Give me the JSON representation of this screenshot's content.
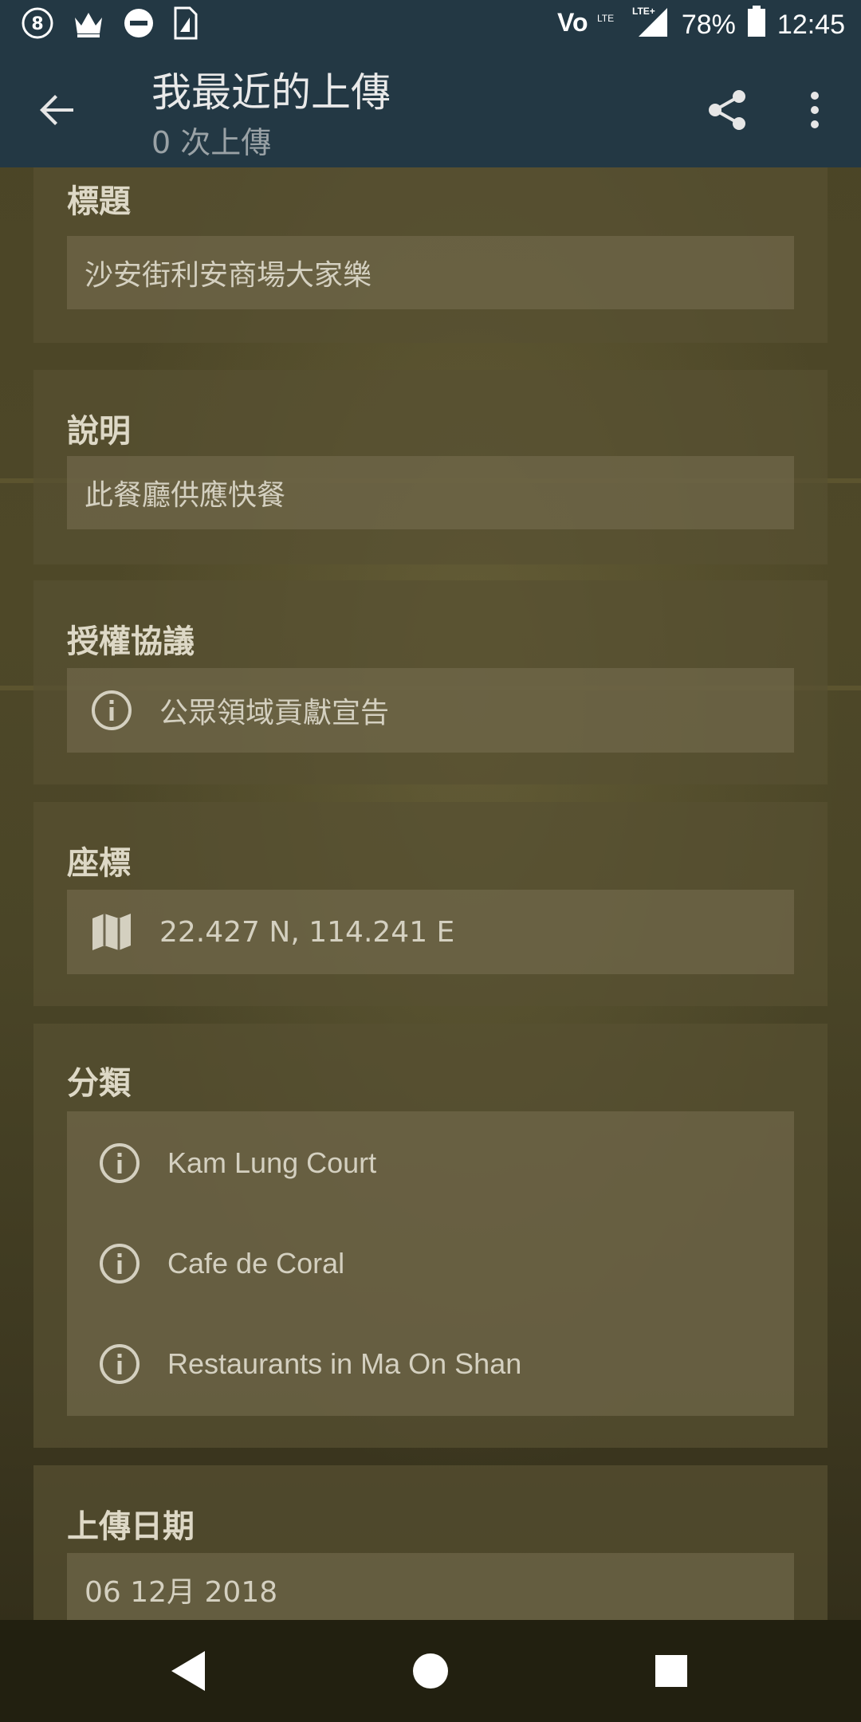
{
  "status_bar": {
    "battery": "78%",
    "time": "12:45",
    "icons": [
      "octopus-icon",
      "crown-icon",
      "dnd-icon",
      "sim-icon",
      "volte-icon",
      "lte-signal-icon",
      "battery-icon"
    ]
  },
  "app_bar": {
    "title": "我最近的上傳",
    "subtitle": "0 次上傳"
  },
  "sections": {
    "title": {
      "label": "標題",
      "value": "沙安街利安商場大家樂"
    },
    "description": {
      "label": "說明",
      "value": "此餐廳供應快餐"
    },
    "license": {
      "label": "授權協議",
      "value": "公眾領域貢獻宣告"
    },
    "coordinates": {
      "label": "座標",
      "value": "22.427 N, 114.241 E"
    },
    "categories": {
      "label": "分類",
      "items": [
        "Kam Lung Court",
        "Cafe de Coral",
        "Restaurants in Ma On Shan"
      ]
    },
    "upload_date": {
      "label": "上傳日期",
      "value": "06 12月 2018"
    }
  },
  "colors": {
    "app_bar": "#233844",
    "card": "#58502f",
    "nav_bar": "#222010"
  }
}
